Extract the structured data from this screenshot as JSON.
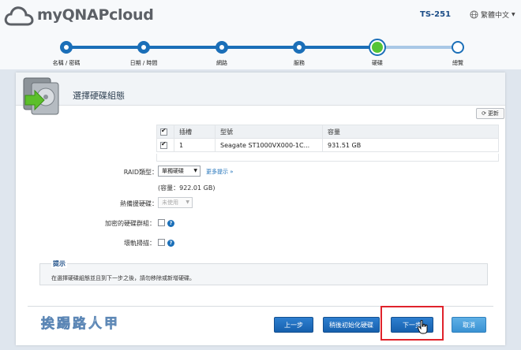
{
  "header": {
    "logo_text": "myQNAPcloud",
    "device_name": "TS-251",
    "language": "繁體中文"
  },
  "steps": [
    {
      "label": "名稱 / 密碼",
      "state": "done"
    },
    {
      "label": "日期 / 時間",
      "state": "done"
    },
    {
      "label": "網路",
      "state": "done"
    },
    {
      "label": "服務",
      "state": "done"
    },
    {
      "label": "硬碟",
      "state": "active"
    },
    {
      "label": "總覽",
      "state": "future"
    }
  ],
  "panel": {
    "title": "選擇硬碟組態",
    "refresh_label": "更新"
  },
  "disk_table": {
    "headers": {
      "slot": "插槽",
      "model": "型號",
      "capacity": "容量"
    },
    "rows": [
      {
        "checked": true,
        "slot": "1",
        "model": "Seagate ST1000VX000-1C...",
        "capacity": "931.51 GB"
      }
    ]
  },
  "form": {
    "raid_label": "RAID類型：",
    "raid_value": "單獨硬碟",
    "more_tips": "更多提示 »",
    "capacity_text": "(容量：922.01 GB)",
    "spare_label": "熱備援硬碟：",
    "spare_value": "未使用",
    "encrypt_label": "加密的硬碟群組：",
    "bad_block_label": "壞軌掃描："
  },
  "tip": {
    "title": "提示",
    "text": "在選擇硬碟組態並且到下一步之後，請勿移除或新增硬碟。"
  },
  "footer": {
    "watermark": "挨踢路人甲",
    "prev_label": "上一步",
    "later_init_label": "稍後初始化硬碟",
    "next_label": "下一步",
    "cancel_label": "取消"
  },
  "colors": {
    "primary": "#1b6fb8",
    "active_step": "#55c435",
    "highlight": "#e0232b"
  }
}
